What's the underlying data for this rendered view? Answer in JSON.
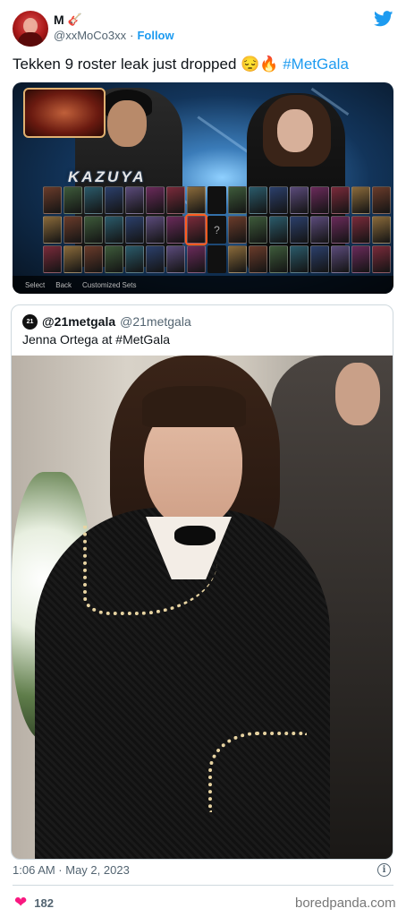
{
  "author": {
    "name": "M",
    "name_icon": "guitar-icon",
    "handle": "@xxMoCo3xx",
    "separator": "·",
    "follow_label": "Follow"
  },
  "tweet": {
    "text": "Tekken 9 roster leak just dropped 😔🔥 ",
    "hashtag": "#MetGala"
  },
  "media": {
    "character_name": "KAZUYA",
    "controls": [
      "Select",
      "Back",
      "Customized Sets"
    ],
    "random_cell": "?"
  },
  "quoted_tweet": {
    "avatar_text": "21",
    "name": "@21metgala",
    "handle": "@21metgala",
    "text": "Jenna Ortega at #MetGala"
  },
  "footer": {
    "timestamp": "1:06 AM · May 2, 2023",
    "info_symbol": "i",
    "likes": "182",
    "watermark": "boredpanda.com"
  },
  "colors": {
    "link": "#1d9bf0",
    "heart": "#f91880",
    "muted": "#536471",
    "twitter_blue": "#1d9bf0"
  }
}
